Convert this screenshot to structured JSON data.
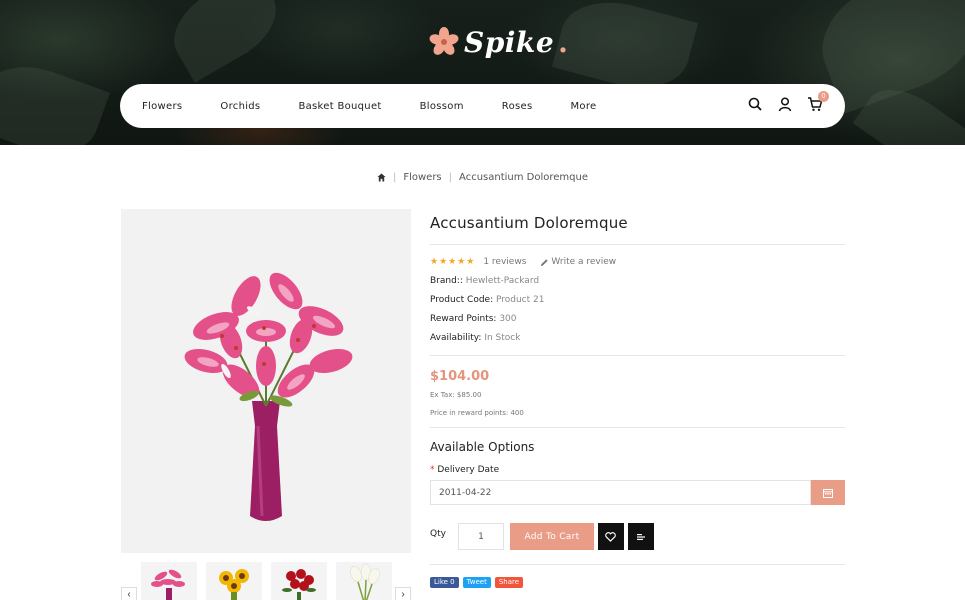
{
  "brand": {
    "name": "Spike",
    "accent": "#e99d86"
  },
  "nav": {
    "items": [
      "Flowers",
      "Orchids",
      "Basket Bouquet",
      "Blossom",
      "Roses",
      "More"
    ],
    "icons": [
      "search-icon",
      "user-icon",
      "cart-icon"
    ],
    "cart_count": "0"
  },
  "breadcrumb": {
    "home_icon": "home-icon",
    "items": [
      "Flowers",
      "Accusantium Doloremque"
    ]
  },
  "product": {
    "title": "Accusantium Doloremque",
    "rating_stars": 5,
    "stars_text": "★★★★★",
    "reviews": "1 reviews",
    "write_review": "Write a review",
    "brand_label": "Brand::",
    "brand_value": "Hewlett-Packard",
    "code_label": "Product Code:",
    "code_value": "Product 21",
    "points_label": "Reward Points:",
    "points_value": "300",
    "availability_label": "Availability:",
    "availability_value": "In Stock",
    "price": "$104.00",
    "ex_tax": "Ex Tax: $85.00",
    "reward_price": "Price in reward points: 400"
  },
  "options": {
    "title": "Available Options",
    "delivery_label": "Delivery Date",
    "required_mark": "*",
    "delivery_value": "2011-04-22"
  },
  "purchase": {
    "qty_label": "Qty",
    "qty_value": "1",
    "add_to_cart": "Add To Cart"
  },
  "social": {
    "like": "Like 0",
    "tweet": "Tweet",
    "share": "Share"
  }
}
